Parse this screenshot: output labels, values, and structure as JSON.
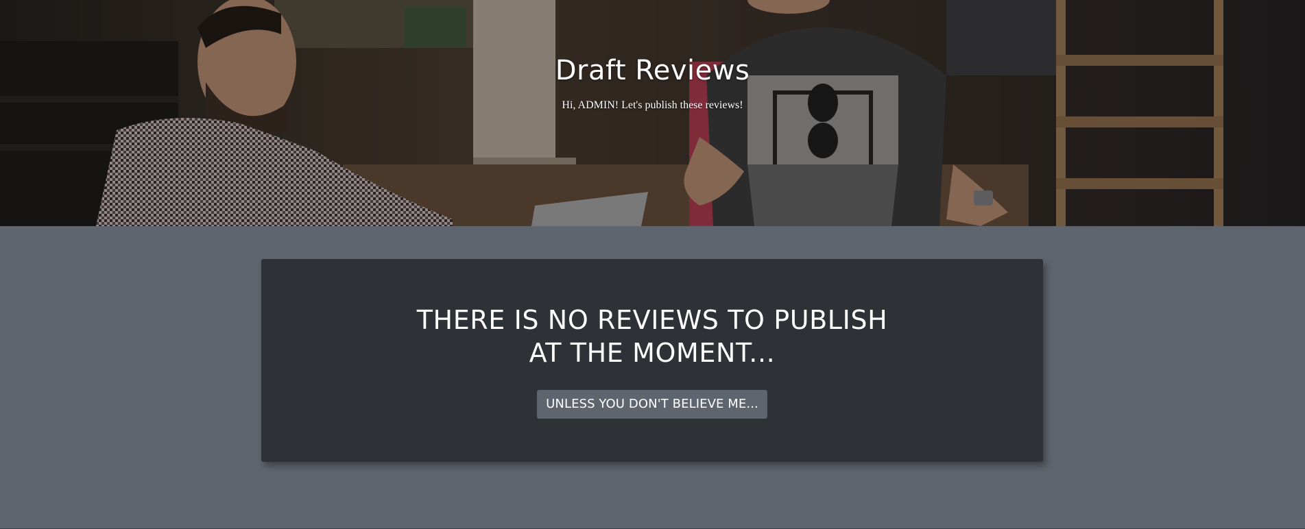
{
  "hero": {
    "title": "Draft Reviews",
    "subtitle": "Hi, ADMIN! Let's publish these reviews!"
  },
  "main": {
    "empty_message_line1": "There is no reviews to publish",
    "empty_message_line2": "at the moment...",
    "action_button_label": "Unless you don't believe me..."
  },
  "colors": {
    "page_background": "#5f656e",
    "card_background": "#2e3135",
    "button_background": "#5f656e",
    "text": "#ffffff"
  }
}
